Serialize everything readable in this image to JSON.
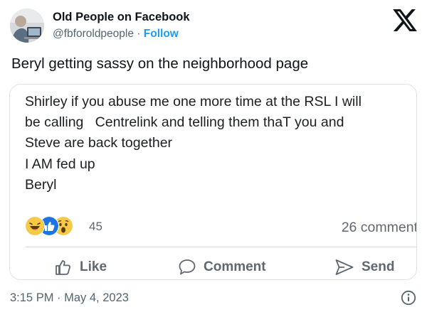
{
  "tweet": {
    "author_name": "Old People on Facebook",
    "handle": "@fbforoldpeople",
    "separator": "·",
    "follow_label": "Follow",
    "text": "Beryl getting sassy on the neighborhood page",
    "timestamp": "3:15 PM · May 4, 2023"
  },
  "embedded_post": {
    "lines": [
      "Shirley if you abuse me one more time at the RSL I will",
      "be calling   Centrelink and telling them thaT you and",
      "Steve are back together",
      "I AM fed up",
      "Beryl"
    ],
    "reactions": {
      "icons": [
        "laugh-reaction-icon",
        "like-reaction-icon",
        "wow-reaction-icon"
      ],
      "count": "45"
    },
    "comments_count": "26 comment",
    "actions": {
      "like": "Like",
      "comment": "Comment",
      "send": "Send"
    }
  },
  "colors": {
    "follow": "#1d9bf0",
    "text_primary": "#0f1419",
    "text_secondary": "#536471",
    "fb_gray": "#606770"
  }
}
